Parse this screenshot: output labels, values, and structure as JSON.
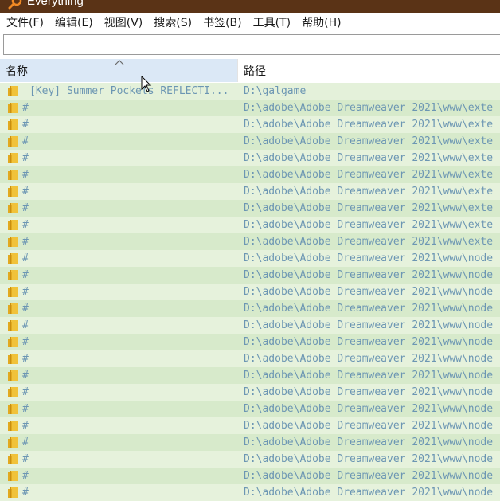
{
  "window": {
    "title": "Everything",
    "icon": "magnifier-app-icon"
  },
  "menu": [
    {
      "label": "文件(F)",
      "name": "menu-file"
    },
    {
      "label": "编辑(E)",
      "name": "menu-edit"
    },
    {
      "label": "视图(V)",
      "name": "menu-view"
    },
    {
      "label": "搜索(S)",
      "name": "menu-search"
    },
    {
      "label": "书签(B)",
      "name": "menu-bookmarks"
    },
    {
      "label": "工具(T)",
      "name": "menu-tools"
    },
    {
      "label": "帮助(H)",
      "name": "menu-help"
    }
  ],
  "search": {
    "value": "",
    "placeholder": ""
  },
  "columns": {
    "name": "名称",
    "path": "路径",
    "sort_icon": "sort-ascending-caret-icon"
  },
  "colors": {
    "titlebar": "#5a3316",
    "header_selected": "#dbe8f6",
    "row_a": "#d7eacb",
    "row_b": "#e6f2dc",
    "text": "#6c96b3",
    "folder": "#f0c23a"
  },
  "rows": [
    {
      "name": "[Key] Summer Pockets REFLECTI...",
      "path": "D:\\galgame"
    },
    {
      "name": "#",
      "path": "D:\\adobe\\Adobe Dreamweaver 2021\\www\\exte"
    },
    {
      "name": "#",
      "path": "D:\\adobe\\Adobe Dreamweaver 2021\\www\\exte"
    },
    {
      "name": "#",
      "path": "D:\\adobe\\Adobe Dreamweaver 2021\\www\\exte"
    },
    {
      "name": "#",
      "path": "D:\\adobe\\Adobe Dreamweaver 2021\\www\\exte"
    },
    {
      "name": "#",
      "path": "D:\\adobe\\Adobe Dreamweaver 2021\\www\\exte"
    },
    {
      "name": "#",
      "path": "D:\\adobe\\Adobe Dreamweaver 2021\\www\\exte"
    },
    {
      "name": "#",
      "path": "D:\\adobe\\Adobe Dreamweaver 2021\\www\\exte"
    },
    {
      "name": "#",
      "path": "D:\\adobe\\Adobe Dreamweaver 2021\\www\\exte"
    },
    {
      "name": "#",
      "path": "D:\\adobe\\Adobe Dreamweaver 2021\\www\\exte"
    },
    {
      "name": "#",
      "path": "D:\\adobe\\Adobe Dreamweaver 2021\\www\\node"
    },
    {
      "name": "#",
      "path": "D:\\adobe\\Adobe Dreamweaver 2021\\www\\node"
    },
    {
      "name": "#",
      "path": "D:\\adobe\\Adobe Dreamweaver 2021\\www\\node"
    },
    {
      "name": "#",
      "path": "D:\\adobe\\Adobe Dreamweaver 2021\\www\\node"
    },
    {
      "name": "#",
      "path": "D:\\adobe\\Adobe Dreamweaver 2021\\www\\node"
    },
    {
      "name": "#",
      "path": "D:\\adobe\\Adobe Dreamweaver 2021\\www\\node"
    },
    {
      "name": "#",
      "path": "D:\\adobe\\Adobe Dreamweaver 2021\\www\\node"
    },
    {
      "name": "#",
      "path": "D:\\adobe\\Adobe Dreamweaver 2021\\www\\node"
    },
    {
      "name": "#",
      "path": "D:\\adobe\\Adobe Dreamweaver 2021\\www\\node"
    },
    {
      "name": "#",
      "path": "D:\\adobe\\Adobe Dreamweaver 2021\\www\\node"
    },
    {
      "name": "#",
      "path": "D:\\adobe\\Adobe Dreamweaver 2021\\www\\node"
    },
    {
      "name": "#",
      "path": "D:\\adobe\\Adobe Dreamweaver 2021\\www\\node"
    },
    {
      "name": "#",
      "path": "D:\\adobe\\Adobe Dreamweaver 2021\\www\\node"
    },
    {
      "name": "#",
      "path": "D:\\adobe\\Adobe Dreamweaver 2021\\www\\node"
    },
    {
      "name": "#",
      "path": "D:\\adobe\\Adobe Dreamweaver 2021\\www\\node"
    }
  ]
}
